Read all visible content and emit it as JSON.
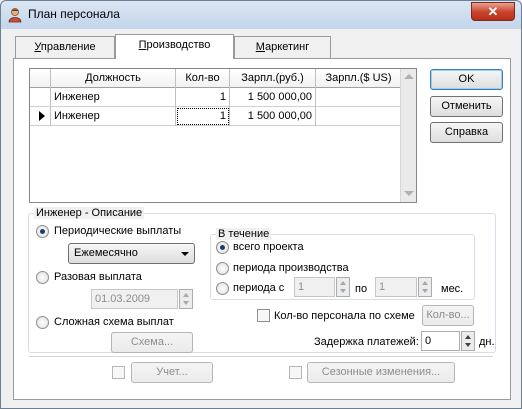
{
  "window": {
    "title": "План персонала",
    "close_label": "✕"
  },
  "tabs": [
    {
      "label": "Управление",
      "accel": "У",
      "rest": "правление",
      "active": false
    },
    {
      "label": "Производство",
      "accel": "П",
      "rest": "роизводство",
      "active": true
    },
    {
      "label": "Маркетинг",
      "accel": "М",
      "rest": "аркетинг",
      "active": false
    }
  ],
  "grid": {
    "columns": [
      "Должность",
      "Кол-во",
      "Зарпл.(руб.)",
      "Зарпл.($ US)"
    ],
    "rows": [
      {
        "role": "Инженер",
        "count": "1",
        "salary_rub": "1 500 000,00",
        "salary_usd": "",
        "current": false
      },
      {
        "role": "Инженер",
        "count": "1",
        "salary_rub": "1 500 000,00",
        "salary_usd": "",
        "current": true
      }
    ]
  },
  "buttons": {
    "ok": "OK",
    "cancel": "Отменить",
    "help": "Справка"
  },
  "description": {
    "title": "Инженер - Описание",
    "periodic": {
      "label": "Периодические выплаты",
      "checked": true
    },
    "frequency": {
      "value": "Ежемесячно"
    },
    "lump": {
      "label": "Разовая выплата",
      "checked": false,
      "date": "01.03.2009"
    },
    "complex": {
      "label": "Сложная схема выплат",
      "checked": false,
      "scheme_button": "Схема..."
    },
    "during": {
      "title": "В течение",
      "whole": {
        "label": "всего проекта",
        "checked": true
      },
      "production": {
        "label": "периода производства",
        "checked": false
      },
      "period": {
        "label": "периода с",
        "from": "1",
        "to_label": "по",
        "to": "1",
        "unit": "мес.",
        "checked": false
      }
    },
    "staff_by_scheme": {
      "label": "Кол-во персонала по схеме",
      "checked": false,
      "button": "Кол-во..."
    },
    "delay": {
      "label": "Задержка платежей:",
      "value": "0",
      "unit": "дн."
    }
  },
  "footer": {
    "account_button": "Учет...",
    "seasonal_button": "Сезонные изменения..."
  }
}
